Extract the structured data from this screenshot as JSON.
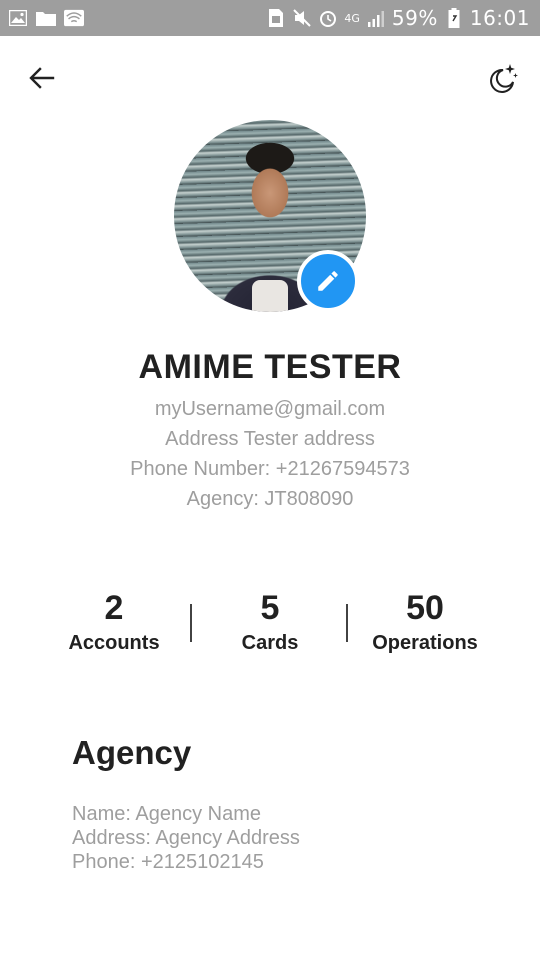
{
  "status_bar": {
    "battery_percent": "59%",
    "time": "16:01",
    "network": "4G",
    "left_icons": [
      "image-icon",
      "folder-icon",
      "wifi-question-icon"
    ],
    "right_icons": [
      "sim-icon",
      "mute-icon",
      "alarm-icon",
      "signal-icon",
      "battery-icon"
    ]
  },
  "toolbar": {
    "back_icon": "arrow-left-icon",
    "theme_icon": "moon-stars-icon"
  },
  "profile": {
    "avatar_icon": "profile-photo",
    "edit_icon": "pencil-icon",
    "name": "AMIME TESTER",
    "email": "myUsername@gmail.com",
    "address": "Address Tester address",
    "phone": "Phone Number: +21267594573",
    "agency": "Agency: JT808090"
  },
  "stats": [
    {
      "value": "2",
      "label": "Accounts"
    },
    {
      "value": "5",
      "label": "Cards"
    },
    {
      "value": "50",
      "label": "Operations"
    }
  ],
  "agency_section": {
    "title": "Agency",
    "name": "Name: Agency Name",
    "address": "Address: Agency Address",
    "phone": "Phone: +2125102145"
  },
  "colors": {
    "status_bar": "#9e9e9e",
    "accent": "#2196f3",
    "primary_text": "#212121",
    "secondary_text": "#9e9e9e"
  }
}
